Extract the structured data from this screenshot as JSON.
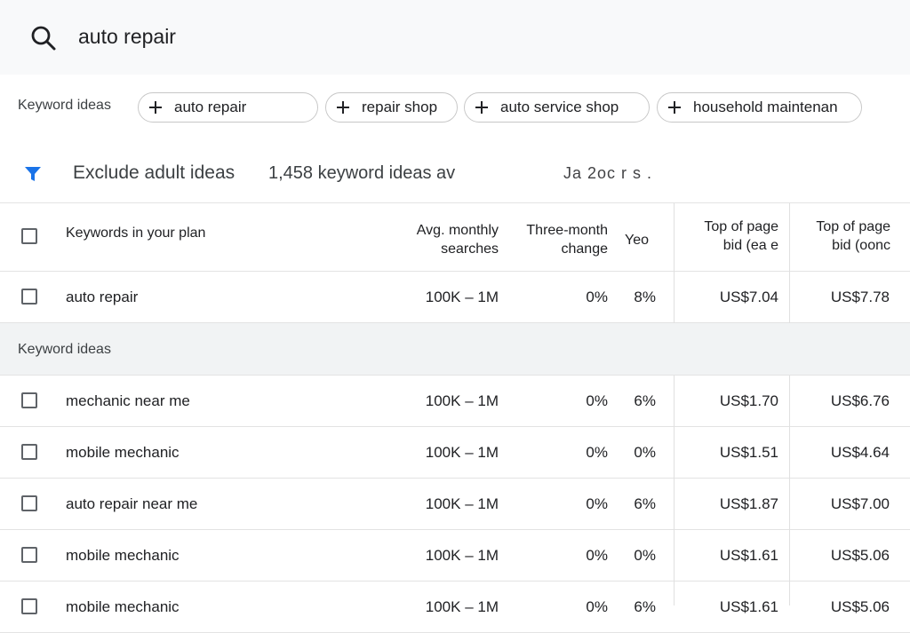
{
  "search": {
    "query": "auto repair"
  },
  "chips": {
    "label": "Keyword ideas",
    "items": [
      {
        "label": "auto repair"
      },
      {
        "label": "repair shop"
      },
      {
        "label": "auto service shop"
      },
      {
        "label": "household maintenan"
      }
    ]
  },
  "filter": {
    "exclude_label": "Exclude adult ideas",
    "ideas_count": "1,458 keyword ideas av",
    "date_range": "Ja  2oc r  s  ."
  },
  "table": {
    "headers": {
      "keyword": "Keywords in your plan",
      "avg_line1": "Avg. monthly",
      "avg_line2": "searches",
      "three_line1": "Three-month",
      "three_line2": "change",
      "yoy": "Yeo",
      "top_low_line1": "Top of page",
      "top_low_line2": "bid (ea e",
      "top_high_line1": "Top of page",
      "top_high_line2": "bid (oonc"
    },
    "plan_rows": [
      {
        "keyword": "auto repair",
        "avg": "100K – 1M",
        "three": "0%",
        "yoy": "8%",
        "low": "US$7.04",
        "high": "US$7.78"
      }
    ],
    "section_label": "Keyword ideas",
    "idea_rows": [
      {
        "keyword": "mechanic near me",
        "avg": "100K – 1M",
        "three": "0%",
        "yoy": "6%",
        "low": "US$1.70",
        "high": "US$6.76"
      },
      {
        "keyword": "mobile mechanic",
        "avg": "100K – 1M",
        "three": "0%",
        "yoy": "0%",
        "low": "US$1.51",
        "high": "US$4.64"
      },
      {
        "keyword": "auto repair near me",
        "avg": "100K – 1M",
        "three": "0%",
        "yoy": "6%",
        "low": "US$1.87",
        "high": "US$7.00"
      },
      {
        "keyword": "mobile mechanic",
        "avg": "100K – 1M",
        "three": "0%",
        "yoy": "0%",
        "low": "US$1.61",
        "high": "US$5.06"
      },
      {
        "keyword": "mobile mechanic",
        "avg": "100K – 1M",
        "three": "0%",
        "yoy": "6%",
        "low": "US$1.61",
        "high": "US$5.06"
      }
    ]
  },
  "colors": {
    "filter_icon": "#1a73e8",
    "border": "#e3e3e3",
    "section_bg": "#f1f3f4"
  }
}
